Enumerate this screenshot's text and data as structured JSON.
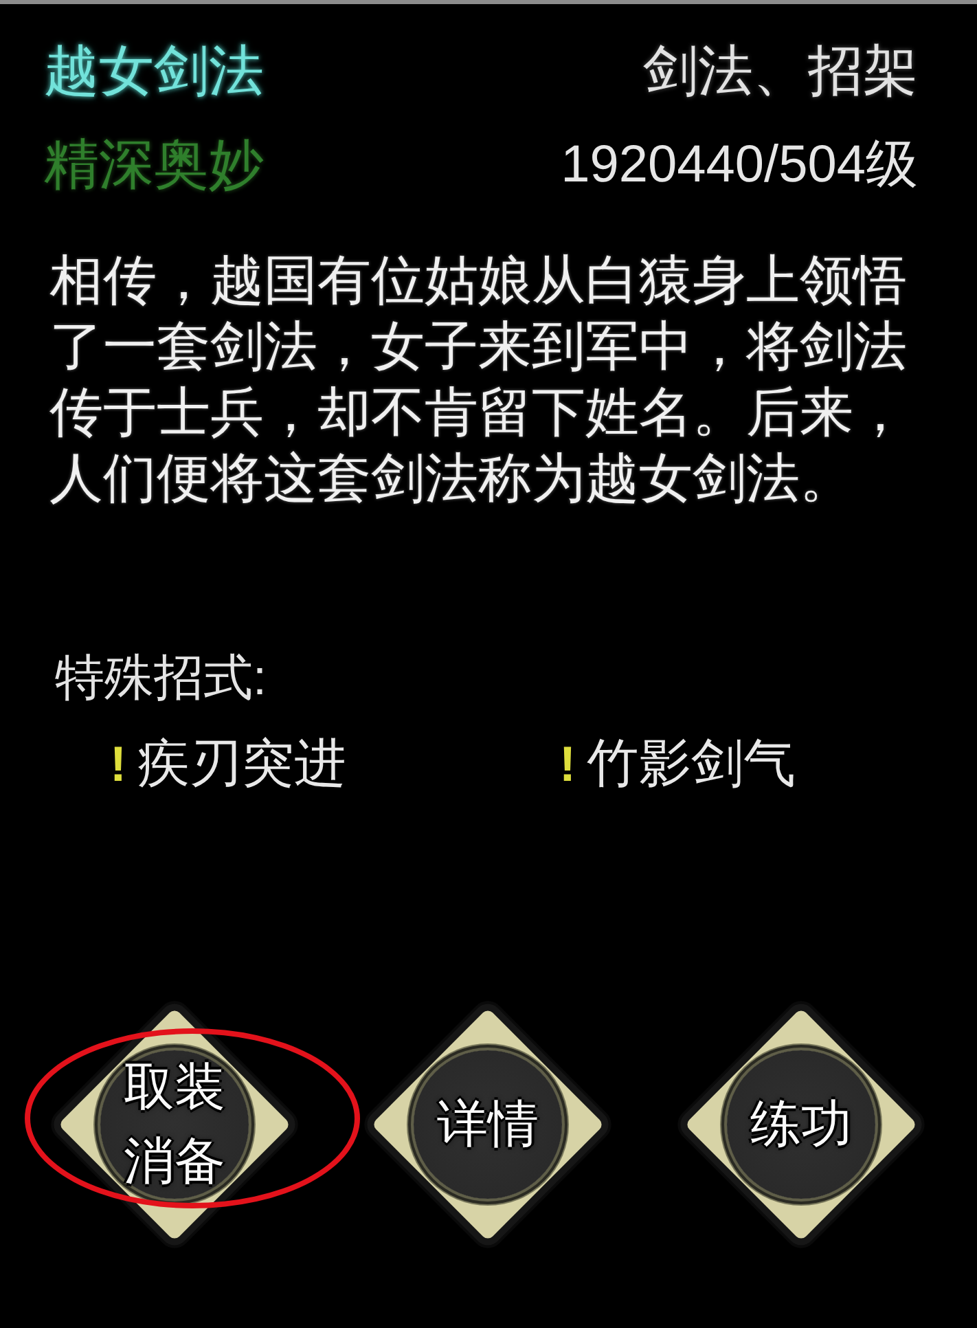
{
  "skill": {
    "name": "越女剑法",
    "realm": "精深奥妙",
    "types": "剑法、招架",
    "progress": "1920440/504级"
  },
  "description": "相传，越国有位姑娘从白猿身上领悟了一套剑法，女子来到军中，将剑法传于士兵，却不肯留下姓名。后来，人们便将这套剑法称为越女剑法。",
  "special_moves": {
    "heading": "特殊招式:",
    "moves": [
      {
        "marker": "!",
        "name": "疾刃突进"
      },
      {
        "marker": "!",
        "name": "竹影剑气"
      }
    ]
  },
  "buttons": [
    {
      "lines": [
        "取装",
        "消备"
      ],
      "circled": true
    },
    {
      "lines": [
        "详情"
      ],
      "circled": false
    },
    {
      "lines": [
        "练功"
      ],
      "circled": false
    }
  ]
}
